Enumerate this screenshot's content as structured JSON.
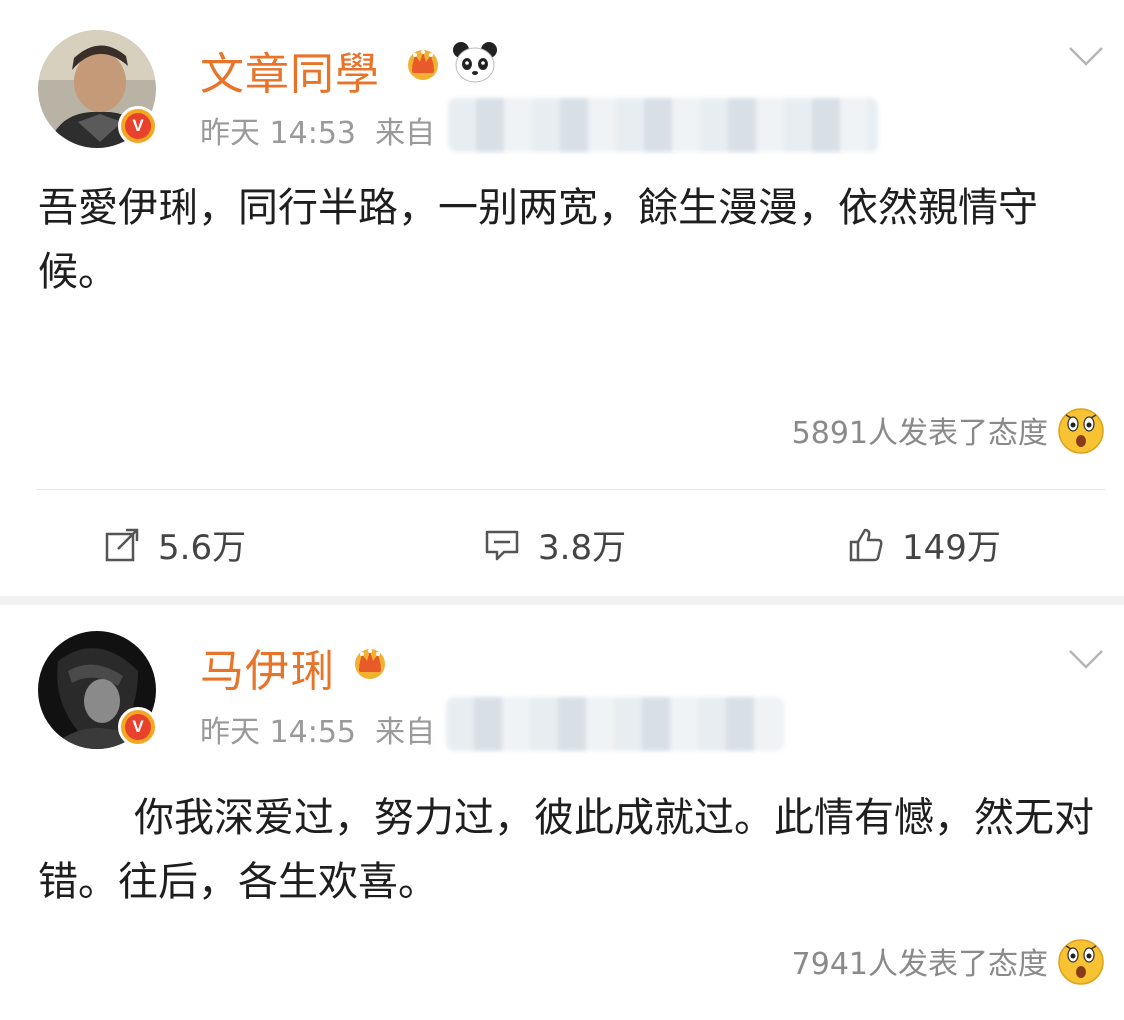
{
  "posts": [
    {
      "username": "文章同學",
      "time": "昨天 14:53",
      "source_prefix": "来自",
      "content": "吾愛伊琍，同行半路，一别两宽，餘生漫漫，依然親情守候。",
      "reactions_text": "5891人发表了态度",
      "actions": {
        "repost": "5.6万",
        "comment": "3.8万",
        "like": "149万"
      }
    },
    {
      "username": "马伊琍",
      "time": "昨天 14:55",
      "source_prefix": "来自",
      "content": "你我深爱过，努力过，彼此成就过。此情有憾，然无对错。往后，各生欢喜。",
      "reactions_text": "7941人发表了态度"
    }
  ],
  "colors": {
    "username": "#e8742a",
    "meta": "#9a9a9a",
    "verified_badge": "#f5a623",
    "separator": "#f2f2f2"
  },
  "icons": [
    "crown-icon",
    "panda-icon",
    "chevron-down-icon",
    "verified-badge-icon",
    "surprised-emoji-icon",
    "repost-icon",
    "comment-icon",
    "like-icon"
  ]
}
